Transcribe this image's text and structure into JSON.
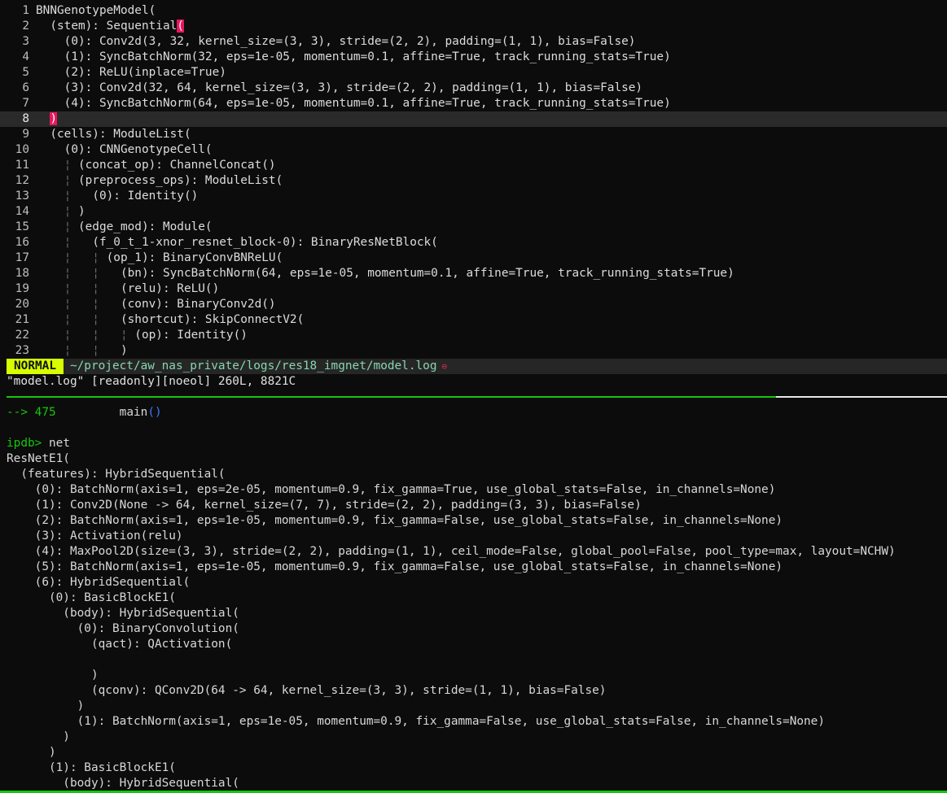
{
  "vim": {
    "lines": [
      {
        "n": "1",
        "pre": "",
        "text": "BNNGenotypeModel("
      },
      {
        "n": "2",
        "pre": "  ",
        "text": "(stem): Sequential",
        "paren": "("
      },
      {
        "n": "3",
        "pre": "    ",
        "text": "(0): Conv2d(3, 32, kernel_size=(3, 3), stride=(2, 2), padding=(1, 1), bias=False)"
      },
      {
        "n": "4",
        "pre": "    ",
        "text": "(1): SyncBatchNorm(32, eps=1e-05, momentum=0.1, affine=True, track_running_stats=True)"
      },
      {
        "n": "5",
        "pre": "    ",
        "text": "(2): ReLU(inplace=True)"
      },
      {
        "n": "6",
        "pre": "    ",
        "text": "(3): Conv2d(32, 64, kernel_size=(3, 3), stride=(2, 2), padding=(1, 1), bias=False)"
      },
      {
        "n": "7",
        "pre": "    ",
        "text": "(4): SyncBatchNorm(64, eps=1e-05, momentum=0.1, affine=True, track_running_stats=True)"
      },
      {
        "n": "8",
        "pre": "  ",
        "text": ")",
        "cursor": true
      },
      {
        "n": "9",
        "pre": "  ",
        "text": "(cells): ModuleList("
      },
      {
        "n": "10",
        "pre": "    ",
        "text": "(0): CNNGenotypeCell("
      },
      {
        "n": "11",
        "pre": "    ¦ ",
        "text": "(concat_op): ChannelConcat()"
      },
      {
        "n": "12",
        "pre": "    ¦ ",
        "text": "(preprocess_ops): ModuleList("
      },
      {
        "n": "13",
        "pre": "    ¦   ",
        "text": "(0): Identity()"
      },
      {
        "n": "14",
        "pre": "    ¦ ",
        "text": ")"
      },
      {
        "n": "15",
        "pre": "    ¦ ",
        "text": "(edge_mod): Module("
      },
      {
        "n": "16",
        "pre": "    ¦   ",
        "text": "(f_0_t_1-xnor_resnet_block-0): BinaryResNetBlock("
      },
      {
        "n": "17",
        "pre": "    ¦   ¦ ",
        "text": "(op_1): BinaryConvBNReLU("
      },
      {
        "n": "18",
        "pre": "    ¦   ¦   ",
        "text": "(bn): SyncBatchNorm(64, eps=1e-05, momentum=0.1, affine=True, track_running_stats=True)"
      },
      {
        "n": "19",
        "pre": "    ¦   ¦   ",
        "text": "(relu): ReLU()"
      },
      {
        "n": "20",
        "pre": "    ¦   ¦   ",
        "text": "(conv): BinaryConv2d()"
      },
      {
        "n": "21",
        "pre": "    ¦   ¦   ",
        "text": "(shortcut): SkipConnectV2("
      },
      {
        "n": "22",
        "pre": "    ¦   ¦   ¦ ",
        "text": "(op): Identity()"
      },
      {
        "n": "23",
        "pre": "    ¦   ¦   ",
        "text": ")"
      }
    ],
    "status": {
      "mode": "NORMAL",
      "path": "~/project/aw_nas_private/logs/res18_imgnet/model.log",
      "ro_icon": "lock-icon"
    },
    "message": "\"model.log\" [readonly][noeol] 260L, 8821C"
  },
  "terminal": {
    "arrow": "-->",
    "lineno": "475",
    "call": "main",
    "call_parens": "()",
    "prompt": "ipdb>",
    "command": "net",
    "output": [
      "ResNetE1(",
      "  (features): HybridSequential(",
      "    (0): BatchNorm(axis=1, eps=2e-05, momentum=0.9, fix_gamma=True, use_global_stats=False, in_channels=None)",
      "    (1): Conv2D(None -> 64, kernel_size=(7, 7), stride=(2, 2), padding=(3, 3), bias=False)",
      "    (2): BatchNorm(axis=1, eps=1e-05, momentum=0.9, fix_gamma=False, use_global_stats=False, in_channels=None)",
      "    (3): Activation(relu)",
      "    (4): MaxPool2D(size=(3, 3), stride=(2, 2), padding=(1, 1), ceil_mode=False, global_pool=False, pool_type=max, layout=NCHW)",
      "    (5): BatchNorm(axis=1, eps=1e-05, momentum=0.9, fix_gamma=False, use_global_stats=False, in_channels=None)",
      "    (6): HybridSequential(",
      "      (0): BasicBlockE1(",
      "        (body): HybridSequential(",
      "          (0): BinaryConvolution(",
      "            (qact): QActivation(",
      "",
      "            )",
      "            (qconv): QConv2D(64 -> 64, kernel_size=(3, 3), stride=(1, 1), bias=False)",
      "          )",
      "          (1): BatchNorm(axis=1, eps=1e-05, momentum=0.9, fix_gamma=False, use_global_stats=False, in_channels=None)",
      "        )",
      "      )",
      "      (1): BasicBlockE1(",
      "        (body): HybridSequential("
    ]
  }
}
